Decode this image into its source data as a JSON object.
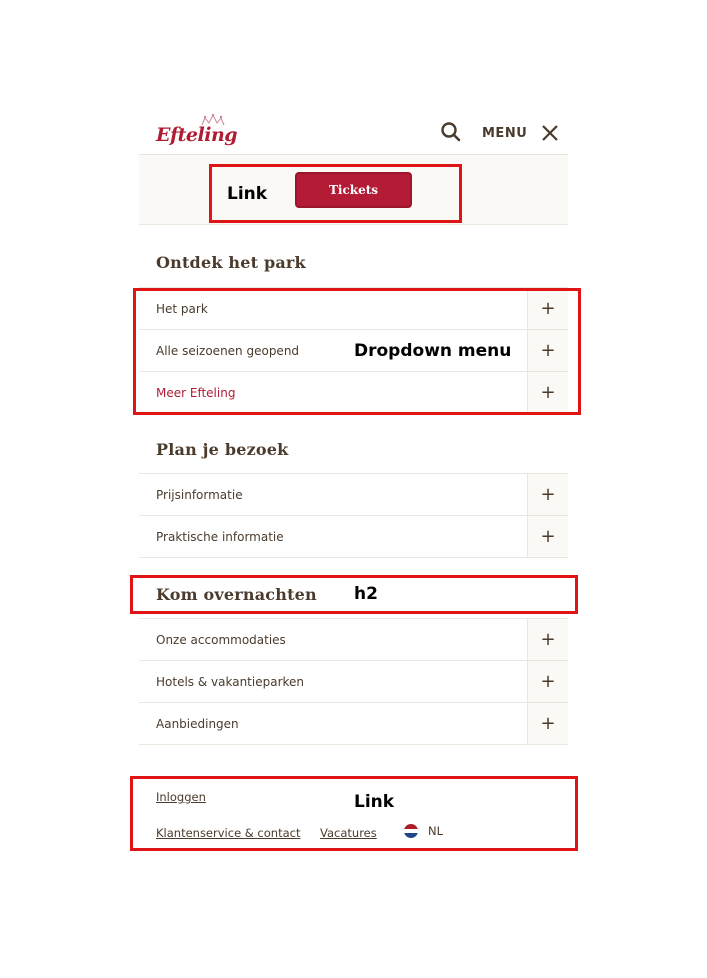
{
  "header": {
    "logo_text": "Efteling",
    "menu_label": "MENU"
  },
  "tickets": {
    "label": "Tickets"
  },
  "sections": [
    {
      "title": "Ontdek het park",
      "items": [
        {
          "label": "Het park",
          "toggle": "+"
        },
        {
          "label": "Alle seizoenen geopend",
          "toggle": "+"
        },
        {
          "label": "Meer Efteling",
          "toggle": "+"
        }
      ]
    },
    {
      "title": "Plan je bezoek",
      "items": [
        {
          "label": "Prijsinformatie",
          "toggle": "+"
        },
        {
          "label": "Praktische informatie",
          "toggle": "+"
        }
      ]
    },
    {
      "title": "Kom overnachten",
      "items": [
        {
          "label": "Onze accommodaties",
          "toggle": "+"
        },
        {
          "label": "Hotels & vakantieparken",
          "toggle": "+"
        },
        {
          "label": "Aanbiedingen",
          "toggle": "+"
        }
      ]
    }
  ],
  "footer": {
    "login": "Inloggen",
    "customer_service": "Klantenservice & contact",
    "vacancies": "Vacatures",
    "language": "NL"
  },
  "annotations": {
    "link_1": "Link",
    "dropdown": "Dropdown menu",
    "h2": "h2",
    "link_2": "Link"
  },
  "colors": {
    "brand": "#b41c35",
    "text": "#4a3b2c",
    "annotation": "#e01414"
  }
}
